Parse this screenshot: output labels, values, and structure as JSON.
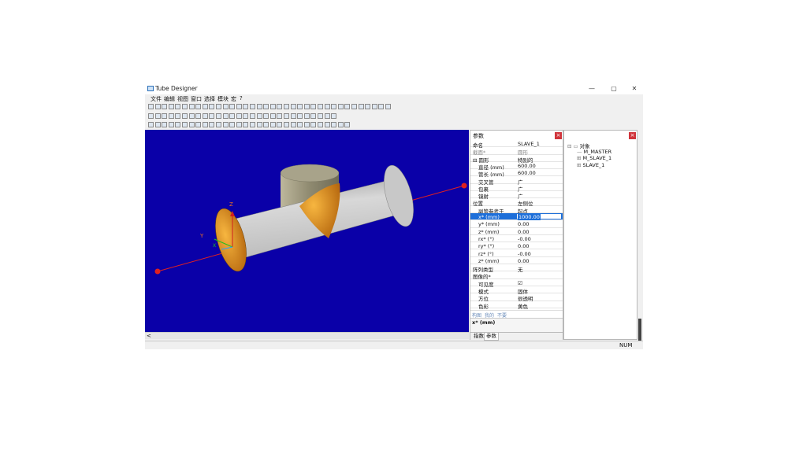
{
  "window": {
    "title": "Tube Designer",
    "controls": {
      "minimize": "—",
      "maximize": "▢",
      "close": "✕"
    }
  },
  "menu": [
    "文件",
    "编辑",
    "视图",
    "窗口",
    "选择",
    "模块",
    "宏",
    "?"
  ],
  "params_panel": {
    "title": "参数",
    "close": "×",
    "rows": [
      {
        "label": "命名",
        "value": "SLAVE_1"
      },
      {
        "label": "截面*",
        "value": "圆形",
        "muted": true
      },
      {
        "label": "⊟ 圆形",
        "value": "特别的"
      },
      {
        "label": "直径 (mm)",
        "value": "600.00"
      },
      {
        "label": "管长 (mm)",
        "value": "600.00"
      },
      {
        "label": "交叉管",
        "value": "广"
      },
      {
        "label": "包裹",
        "value": "广"
      },
      {
        "label": "镜射",
        "value": "广"
      },
      {
        "label": "位置",
        "value": "左侧位"
      },
      {
        "label": "副管参考于",
        "value": "起点"
      },
      {
        "label": "x* (mm)",
        "value": "1000.00",
        "selected": true
      },
      {
        "label": "y* (mm)",
        "value": "0.00"
      },
      {
        "label": "z* (mm)",
        "value": "0.00"
      },
      {
        "label": "rx* (°)",
        "value": "-0.00"
      },
      {
        "label": "ry* (°)",
        "value": "0.00"
      },
      {
        "label": "rz* (°)",
        "value": "-0.00"
      },
      {
        "label": "z* (mm)",
        "value": "0.00"
      },
      {
        "label": "阵列类型",
        "value": "无"
      },
      {
        "label": "图像的*",
        "value": ""
      },
      {
        "label": "可见度",
        "value": "☑"
      },
      {
        "label": "模式",
        "value": "固体"
      },
      {
        "label": "方位",
        "value": "很透明"
      },
      {
        "label": "色彩",
        "value": "黄色"
      }
    ],
    "desc_tabs": [
      "构图",
      "我的",
      "不要"
    ],
    "description_label": "x* (mm)",
    "bottom_tabs": [
      {
        "label": "指数",
        "active": false
      },
      {
        "label": "参数",
        "active": true
      }
    ]
  },
  "objects_panel": {
    "close": "×",
    "tree": [
      {
        "prefix": "⊟ ▭",
        "label": "对象",
        "indent": 0
      },
      {
        "prefix": "—",
        "label": "M_MASTER",
        "indent": 1
      },
      {
        "prefix": "⊞",
        "label": "M_SLAVE_1",
        "indent": 1
      },
      {
        "prefix": "⊞",
        "label": "SLAVE_1",
        "indent": 1
      }
    ]
  },
  "viewport": {
    "background": "#0a00a8",
    "axes": {
      "x": "X",
      "y": "Y",
      "z": "Z"
    },
    "scroll_left": "<"
  },
  "status": {
    "num": "NUM"
  },
  "colors": {
    "tube": "#c4c4c4",
    "cap": "#e59a2a",
    "axis_line": "#e02020",
    "branch": "#8f8a70"
  }
}
